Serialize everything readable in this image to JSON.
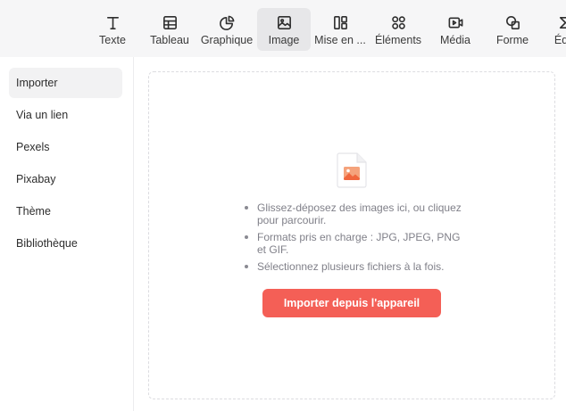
{
  "toolbar": {
    "items": [
      {
        "label": "Texte",
        "icon": "text-icon"
      },
      {
        "label": "Tableau",
        "icon": "table-icon"
      },
      {
        "label": "Graphique",
        "icon": "chart-icon"
      },
      {
        "label": "Image",
        "icon": "image-icon",
        "active": true
      },
      {
        "label": "Mise en ...",
        "icon": "layout-icon"
      },
      {
        "label": "Éléments",
        "icon": "elements-icon"
      },
      {
        "label": "Média",
        "icon": "media-icon"
      },
      {
        "label": "Forme",
        "icon": "shape-icon"
      },
      {
        "label": "Équ",
        "icon": "equation-icon"
      }
    ]
  },
  "sidebar": {
    "items": [
      {
        "label": "Importer",
        "active": true
      },
      {
        "label": "Via un lien"
      },
      {
        "label": "Pexels"
      },
      {
        "label": "Pixabay"
      },
      {
        "label": "Thème"
      },
      {
        "label": "Bibliothèque"
      }
    ]
  },
  "dropzone": {
    "icon": "image-file-icon",
    "hints": [
      "Glissez-déposez des images ici, ou cliquez pour parcourir.",
      "Formats pris en charge : JPG, JPEG, PNG et GIF.",
      "Sélectionnez plusieurs fichiers à la fois."
    ],
    "button_label": "Importer depuis l'appareil"
  },
  "colors": {
    "accent": "#f45f56",
    "toolbar_bg": "#f6f6f7",
    "active_bg": "#e7e7e9"
  }
}
